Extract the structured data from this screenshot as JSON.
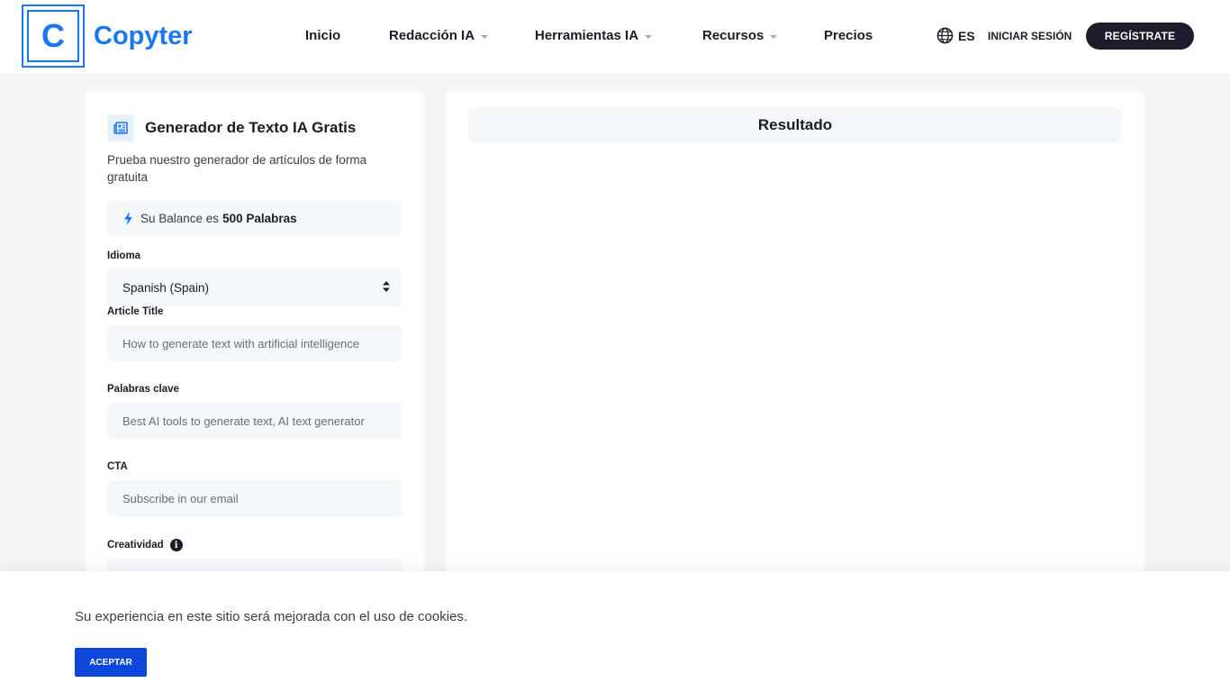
{
  "header": {
    "logo_letter": "C",
    "logo_text": "Copyter",
    "nav": [
      {
        "label": "Inicio"
      },
      {
        "label": "Redacción IA"
      },
      {
        "label": "Herramientas IA"
      },
      {
        "label": "Recursos"
      },
      {
        "label": "Precios"
      }
    ],
    "language": "ES",
    "login_label": "INICIAR SESIÓN",
    "register_label": "REGÍSTRATE"
  },
  "form": {
    "title": "Generador de Texto IA Gratis",
    "description": "Prueba nuestro generador de artículos de forma gratuita",
    "balance_prefix": "Su Balance es",
    "balance_value": "500 Palabras",
    "language_label": "Idioma",
    "language_value": "Spanish (Spain)",
    "article_title_label": "Article Title",
    "article_title_placeholder": "How to generate text with artificial intelligence",
    "keywords_label": "Palabras clave",
    "keywords_placeholder": "Best AI tools to generate text, AI text generator",
    "cta_label": "CTA",
    "cta_placeholder": "Subscribe in our email",
    "creativity_label": "Creatividad"
  },
  "result": {
    "title": "Resultado"
  },
  "cookie": {
    "message": "Su experiencia en este sitio será mejorada con el uso de cookies.",
    "accept_label": "ACEPTAR"
  },
  "colors": {
    "brand": "#1877f2",
    "dark": "#1c1c2c",
    "accept": "#0d47d9"
  }
}
